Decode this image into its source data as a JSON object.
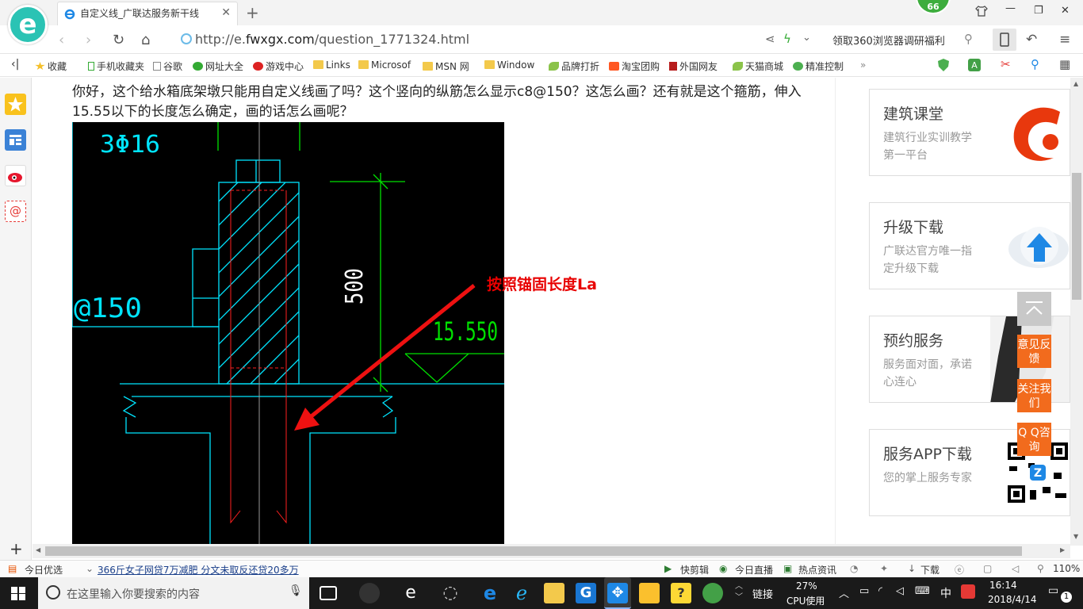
{
  "browser": {
    "tab_title": "自定义线_广联达服务新干线",
    "url": "http://e.fwxgx.com/question_1771324.html",
    "url_scheme": "http://e.",
    "url_domain": "fwxgx.com",
    "url_path": "/question_1771324.html",
    "badge_count": "66",
    "promo_text": "领取360浏览器调研福利",
    "new_tab": "+",
    "close_tab": "✕"
  },
  "favorites": [
    {
      "label": "收藏",
      "icon": "star-icon"
    },
    {
      "label": "手机收藏夹",
      "icon": "phone-icon"
    },
    {
      "label": "谷歌",
      "icon": "page-icon"
    },
    {
      "label": "网址大全",
      "icon": "globe-icon"
    },
    {
      "label": "游戏中心",
      "icon": "game-icon"
    },
    {
      "label": "Links",
      "icon": "folder-icon"
    },
    {
      "label": "Microsof",
      "icon": "folder-icon"
    },
    {
      "label": "MSN 网",
      "icon": "folder-icon"
    },
    {
      "label": "Window",
      "icon": "folder-icon"
    },
    {
      "label": "品牌打折",
      "icon": "leaf-icon"
    },
    {
      "label": "淘宝团购",
      "icon": "taobao-icon"
    },
    {
      "label": "外国网友",
      "icon": "flag-icon"
    },
    {
      "label": "天猫商城",
      "icon": "leaf-icon"
    },
    {
      "label": "精准控制",
      "icon": "chat-icon"
    }
  ],
  "question": {
    "text": "你好，这个给水箱底架墩只能用自定义线画了吗？这个竖向的纵筋怎么显示c8@150？这怎么画？还有就是这个箍筋，伸入15.55以下的长度怎么确定，画的话怎么画呢？"
  },
  "cad": {
    "label_rebar": "3Φ16",
    "label_spacing": "@150",
    "label_dim": "500",
    "label_elev": "15.550",
    "annotation": "按照锚固长度La"
  },
  "right_cards": [
    {
      "title": "建筑课堂",
      "subtitle": "建筑行业实训教学第一平台"
    },
    {
      "title": "升级下载",
      "subtitle": "广联达官方唯一指定升级下载"
    },
    {
      "title": "预约服务",
      "subtitle": "服务面对面，承诺心连心"
    },
    {
      "title": "服务APP下载",
      "subtitle": "您的掌上服务专家"
    }
  ],
  "float_buttons": [
    "意见反馈",
    "关注我们",
    "Q Q咨询"
  ],
  "status_bar": {
    "today": "今日优选",
    "news": "366斤女子网贷7万减肥 分文未取反还贷20多万",
    "quick_clip": "快剪辑",
    "live": "今日直播",
    "hot": "热点资讯",
    "download": "下载",
    "zoom": "110%"
  },
  "taskbar": {
    "search_placeholder": "在这里输入你要搜索的内容",
    "link": "链接",
    "cpu_percent": "27%",
    "cpu_label": "CPU使用",
    "ime": "中",
    "time": "16:14",
    "date": "2018/4/14",
    "notifications": "1"
  }
}
